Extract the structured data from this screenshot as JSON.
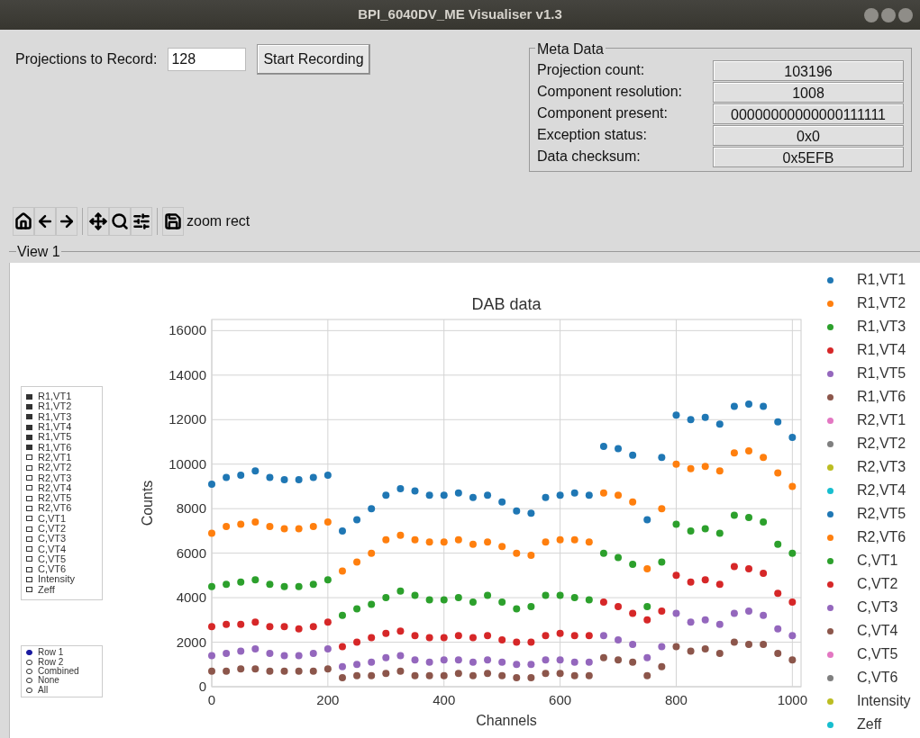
{
  "window": {
    "title": "BPI_6040DV_ME Visualiser v1.3"
  },
  "recording": {
    "label": "Projections to Record:",
    "value": "128",
    "button": "Start Recording"
  },
  "meta_data": {
    "title": "Meta Data",
    "rows": [
      {
        "label": "Projection count:",
        "value": "103196"
      },
      {
        "label": "Component resolution:",
        "value": "1008"
      },
      {
        "label": "Component present:",
        "value": "00000000000000111111"
      },
      {
        "label": "Exception status:",
        "value": "0x0"
      },
      {
        "label": "Data checksum:",
        "value": "0x5EFB"
      }
    ]
  },
  "toolbar": {
    "buttons": [
      {
        "kind": "home"
      },
      {
        "kind": "back"
      },
      {
        "kind": "forward"
      },
      {
        "kind": "pan"
      },
      {
        "kind": "zoom"
      },
      {
        "kind": "configure"
      },
      {
        "kind": "save"
      }
    ],
    "mode": "zoom rect"
  },
  "view": {
    "title": "View 1",
    "series_checks": [
      {
        "label": "R1,VT1",
        "checked": true
      },
      {
        "label": "R1,VT2",
        "checked": true
      },
      {
        "label": "R1,VT3",
        "checked": true
      },
      {
        "label": "R1,VT4",
        "checked": true
      },
      {
        "label": "R1,VT5",
        "checked": true
      },
      {
        "label": "R1,VT6",
        "checked": true
      },
      {
        "label": "R2,VT1",
        "checked": false
      },
      {
        "label": "R2,VT2",
        "checked": false
      },
      {
        "label": "R2,VT3",
        "checked": false
      },
      {
        "label": "R2,VT4",
        "checked": false
      },
      {
        "label": "R2,VT5",
        "checked": false
      },
      {
        "label": "R2,VT6",
        "checked": false
      },
      {
        "label": "C,VT1",
        "checked": false
      },
      {
        "label": "C,VT2",
        "checked": false
      },
      {
        "label": "C,VT3",
        "checked": false
      },
      {
        "label": "C,VT4",
        "checked": false
      },
      {
        "label": "C,VT5",
        "checked": false
      },
      {
        "label": "C,VT6",
        "checked": false
      },
      {
        "label": "Intensity",
        "checked": false
      },
      {
        "label": "Zeff",
        "checked": false
      }
    ],
    "row_options": [
      {
        "label": "Row 1",
        "selected": true
      },
      {
        "label": "Row 2",
        "selected": false
      },
      {
        "label": "Combined",
        "selected": false
      },
      {
        "label": "None",
        "selected": false
      },
      {
        "label": "All",
        "selected": false
      }
    ],
    "chart_data": {
      "type": "scatter",
      "title": "DAB data",
      "xlabel": "Channels",
      "ylabel": "Counts",
      "xlim": [
        0,
        1015
      ],
      "ylim": [
        0,
        16500
      ],
      "xticks": [
        0,
        200,
        400,
        600,
        800,
        1000
      ],
      "yticks": [
        0,
        2000,
        4000,
        6000,
        8000,
        10000,
        12000,
        14000,
        16000
      ],
      "x": [
        0,
        25,
        50,
        75,
        100,
        125,
        150,
        175,
        200,
        225,
        250,
        275,
        300,
        325,
        350,
        375,
        400,
        425,
        450,
        475,
        500,
        525,
        550,
        575,
        600,
        625,
        650,
        675,
        700,
        725,
        750,
        775,
        800,
        825,
        850,
        875,
        900,
        925,
        950,
        975,
        1000
      ],
      "series": [
        {
          "name": "R1,VT1",
          "color": "#1f77b4",
          "values": [
            9100,
            9400,
            9500,
            9700,
            9400,
            9300,
            9300,
            9400,
            9500,
            7000,
            7500,
            8000,
            8600,
            8900,
            8800,
            8600,
            8600,
            8700,
            8500,
            8600,
            8300,
            7900,
            7800,
            8500,
            8600,
            8700,
            8600,
            10800,
            10700,
            10400,
            7500,
            10300,
            12200,
            12000,
            12100,
            11800,
            12600,
            12700,
            12600,
            11900,
            11200
          ]
        },
        {
          "name": "R1,VT2",
          "color": "#ff7f0e",
          "values": [
            6900,
            7200,
            7300,
            7400,
            7200,
            7100,
            7100,
            7200,
            7400,
            5200,
            5600,
            6000,
            6600,
            6800,
            6600,
            6500,
            6500,
            6600,
            6400,
            6500,
            6300,
            6000,
            5900,
            6500,
            6600,
            6600,
            6500,
            8700,
            8600,
            8300,
            5300,
            8000,
            10000,
            9800,
            9900,
            9700,
            10500,
            10600,
            10300,
            9600,
            9000
          ]
        },
        {
          "name": "R1,VT3",
          "color": "#2ca02c",
          "values": [
            4500,
            4600,
            4700,
            4800,
            4600,
            4500,
            4500,
            4600,
            4800,
            3200,
            3500,
            3700,
            4000,
            4300,
            4100,
            3900,
            3900,
            4000,
            3800,
            4100,
            3800,
            3500,
            3600,
            4100,
            4100,
            4000,
            3900,
            6000,
            5800,
            5500,
            3600,
            5600,
            7300,
            7000,
            7100,
            6900,
            7700,
            7600,
            7400,
            6400,
            6000
          ]
        },
        {
          "name": "R1,VT4",
          "color": "#d62728",
          "values": [
            2700,
            2800,
            2800,
            2900,
            2700,
            2700,
            2600,
            2700,
            2900,
            1800,
            2000,
            2200,
            2400,
            2500,
            2300,
            2200,
            2200,
            2300,
            2200,
            2300,
            2100,
            2000,
            2000,
            2300,
            2400,
            2300,
            2300,
            3800,
            3600,
            3300,
            3000,
            3400,
            5000,
            4700,
            4800,
            4600,
            5400,
            5300,
            5100,
            4200,
            3800
          ]
        },
        {
          "name": "R1,VT5",
          "color": "#9467bd",
          "values": [
            1400,
            1500,
            1600,
            1700,
            1500,
            1400,
            1400,
            1500,
            1700,
            900,
            1000,
            1100,
            1300,
            1400,
            1200,
            1100,
            1200,
            1200,
            1100,
            1200,
            1100,
            1000,
            1000,
            1200,
            1200,
            1100,
            1100,
            2300,
            2100,
            1900,
            1300,
            1800,
            3300,
            2900,
            3000,
            2800,
            3300,
            3400,
            3200,
            2600,
            2300
          ]
        },
        {
          "name": "R1,VT6",
          "color": "#8c564b",
          "values": [
            700,
            700,
            800,
            800,
            700,
            700,
            700,
            700,
            800,
            400,
            500,
            500,
            600,
            700,
            500,
            500,
            500,
            600,
            500,
            600,
            500,
            400,
            400,
            600,
            600,
            500,
            500,
            1300,
            1200,
            1100,
            500,
            900,
            1800,
            1600,
            1700,
            1500,
            2000,
            1900,
            1900,
            1500,
            1200
          ]
        }
      ],
      "grid": true
    },
    "legend": [
      {
        "label": "R2,VT1",
        "color": "#e377c2"
      },
      {
        "label": "R2,VT2",
        "color": "#7f7f7f"
      },
      {
        "label": "R2,VT3",
        "color": "#bcbd22"
      },
      {
        "label": "R2,VT4",
        "color": "#17becf"
      },
      {
        "label": "R2,VT5",
        "color": "#1f77b4"
      },
      {
        "label": "R2,VT6",
        "color": "#ff7f0e"
      },
      {
        "label": "C,VT1",
        "color": "#2ca02c"
      },
      {
        "label": "C,VT2",
        "color": "#d62728"
      },
      {
        "label": "C,VT3",
        "color": "#9467bd"
      },
      {
        "label": "C,VT4",
        "color": "#8c564b"
      },
      {
        "label": "C,VT5",
        "color": "#e377c2"
      },
      {
        "label": "C,VT6",
        "color": "#7f7f7f"
      },
      {
        "label": "Intensity",
        "color": "#bcbd22"
      },
      {
        "label": "Zeff",
        "color": "#17becf"
      }
    ]
  }
}
